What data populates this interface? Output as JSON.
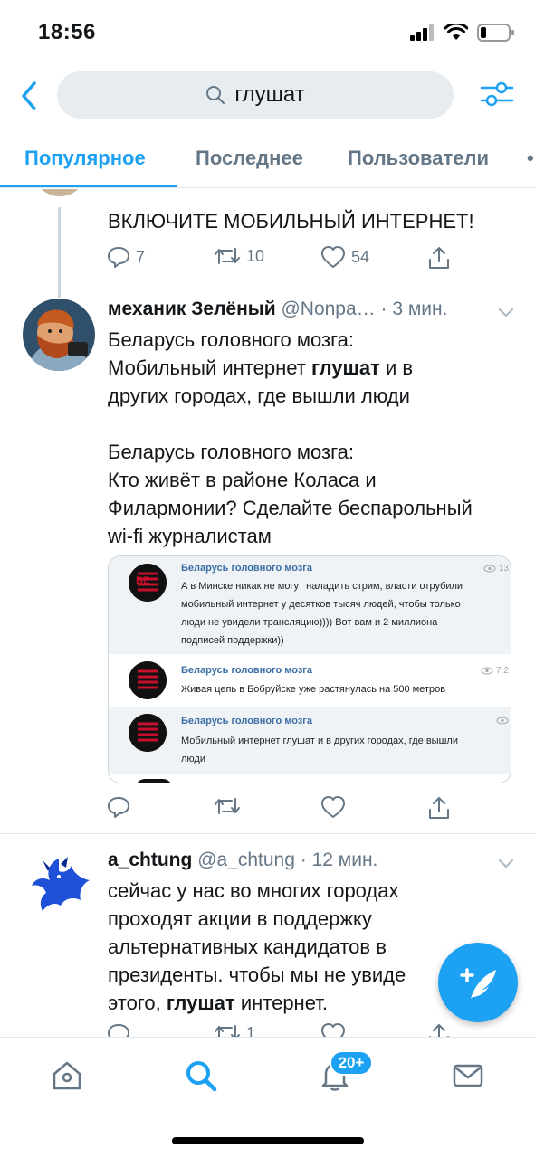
{
  "status_bar": {
    "time": "18:56"
  },
  "search": {
    "query": "глушат"
  },
  "tabs": [
    "Популярное",
    "Последнее",
    "Пользователи"
  ],
  "tweet_prev": {
    "text": "ВКЛЮЧИТЕ МОБИЛЬНЫЙ ИНТЕРНЕТ!",
    "replies": "7",
    "retweets": "10",
    "likes": "54"
  },
  "tweet1": {
    "name": "механик Зелёный",
    "handle": "@Nonpa…",
    "time": "· 3 мин.",
    "line1": "Беларусь головного мозга:",
    "line2_pre": "Мобильный интернет ",
    "line2_bold": "глушат",
    "line2_post": " и в",
    "line3": "других городах, где вышли люди",
    "line4": "Беларусь головного мозга:",
    "line5": "Кто живёт в районе Коласа и",
    "line6": "Филармонии? Сделайте беспарольный",
    "line7": "wi-fi журналистам",
    "media": [
      {
        "channel": "Беларусь головного мозга",
        "views": "13",
        "text_lines": [
          "А в Минске никак не могут наладить стрим, власти отрубили",
          "мобильный интернет у десятков тысяч людей, чтобы только",
          "люди не увидели трансляцию)))) Вот вам и 2 миллиона",
          "подписей поддержки))"
        ]
      },
      {
        "channel": "Беларусь головного мозга",
        "views": "7.2",
        "text_lines": [
          "Живая цепь в Бобруйске уже растянулась на 500 метров"
        ]
      },
      {
        "channel": "Беларусь головного мозга",
        "views": "",
        "text_lines": [
          "Мобильный интернет глушат и в других городах, где вышли",
          "люди"
        ]
      }
    ],
    "logo_text": "BE",
    "logo_sub": "BELAMOVA"
  },
  "tweet2": {
    "name": "a_chtung",
    "handle": "@a_chtung",
    "time": "· 12 мин.",
    "line1": "сейчас у нас во многих городах",
    "line2": "проходят акции в поддержку",
    "line3": "альтернативных кандидатов в",
    "line4": "президенты. чтобы мы не увиде",
    "line5_pre": "этого, ",
    "line5_bold": "глушат",
    "line5_post": " интернет.",
    "retweets": "1"
  },
  "bottom_nav": {
    "notifications_badge": "20+"
  },
  "colors": {
    "accent": "#1da1f2",
    "secondary_text": "#657786"
  }
}
